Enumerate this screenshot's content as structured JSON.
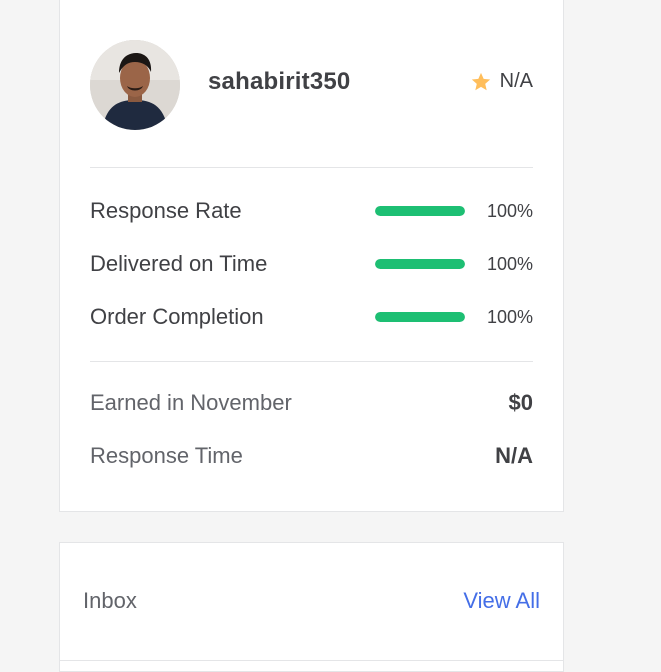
{
  "profile": {
    "username": "sahabirit350",
    "rating": {
      "icon": "star-icon",
      "value": "N/A",
      "star_color": "#ffbe5b"
    },
    "avatar": {
      "icon": "user-photo"
    }
  },
  "metrics": [
    {
      "label": "Response Rate",
      "value": "100%",
      "progress": 1.0
    },
    {
      "label": "Delivered on Time",
      "value": "100%",
      "progress": 1.0
    },
    {
      "label": "Order Completion",
      "value": "100%",
      "progress": 1.0
    }
  ],
  "stats": [
    {
      "label": "Earned in November",
      "value": "$0"
    },
    {
      "label": "Response Time",
      "value": "N/A"
    }
  ],
  "inbox": {
    "title": "Inbox",
    "view_all": "View All"
  },
  "colors": {
    "progress": "#1dbf73",
    "link": "#446ee7",
    "text": "#404145",
    "muted": "#62646a"
  }
}
